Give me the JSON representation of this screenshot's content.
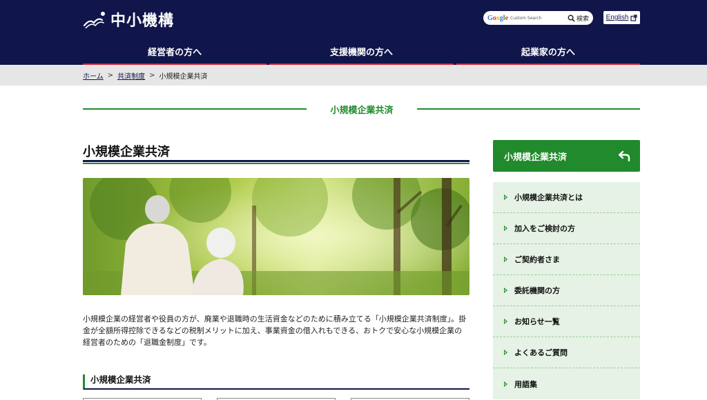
{
  "header": {
    "logo_text": "中小機構",
    "search": {
      "google_label": "Google",
      "placeholder": "Custom Search",
      "button_label": "検索"
    },
    "english_label": "English",
    "nav": [
      "経営者の方へ",
      "支援機関の方へ",
      "起業家の方へ"
    ]
  },
  "breadcrumb": {
    "home": "ホーム",
    "section": "共済制度",
    "current": "小規模企業共済",
    "separator": ">"
  },
  "section_heading": "小規模企業共済",
  "main": {
    "page_title": "小規模企業共済",
    "description": "小規模企業の経営者や役員の方が、廃業や退職時の生活資金などのために積み立てる「小規模企業共済制度」。掛金が全額所得控除できるなどの税制メリットに加え、事業資金の借入れもできる、おトクで安心な小規模企業の経営者のための「退職金制度」です。",
    "sub_title": "小規模企業共済"
  },
  "sidebar": {
    "heading": "小規模企業共済",
    "items": [
      "小規模企業共済とは",
      "加入をご検討の方",
      "ご契約者さま",
      "委託機関の方",
      "お知らせ一覧",
      "よくあるご質問",
      "用語集"
    ]
  },
  "colors": {
    "navy": "#10154a",
    "green": "#208a2c",
    "red": "#c8283c",
    "side_bg": "#e5f2e5"
  }
}
